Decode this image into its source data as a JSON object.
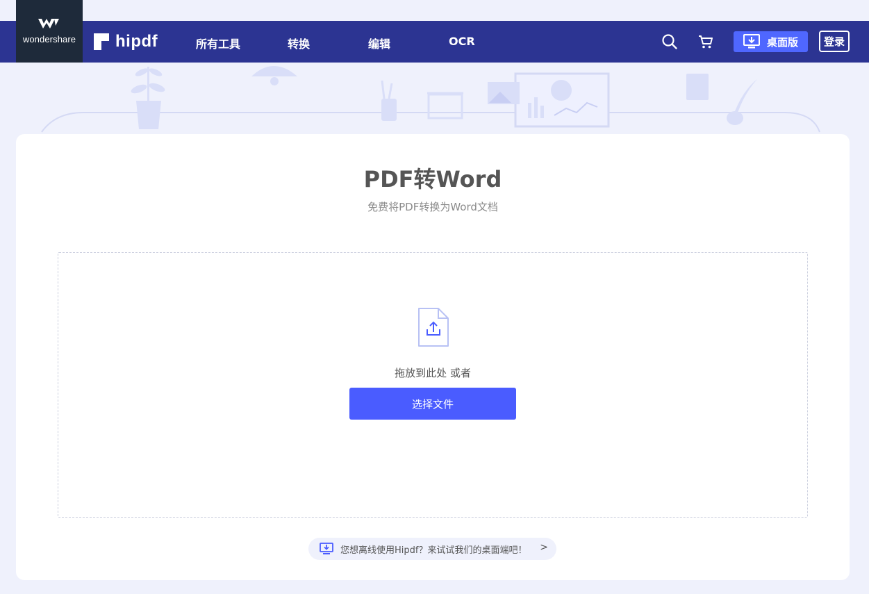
{
  "brand": {
    "wondershare": "wondershare",
    "hipdf": "hipdf"
  },
  "nav": {
    "items": [
      "所有工具",
      "转换",
      "编辑",
      "OCR"
    ],
    "search_icon": "search-icon",
    "cart_icon": "cart-icon",
    "desktop_label": "桌面版",
    "login_label": "登录"
  },
  "main": {
    "title": "PDF转Word",
    "subtitle": "免费将PDF转换为Word文档",
    "drop_text": "拖放到此处 或者",
    "choose_button": "选择文件",
    "promo_text": "您想离线使用Hipdf？来试试我们的桌面端吧！",
    "promo_chevron": ">"
  },
  "colors": {
    "nav_bg": "#2c3492",
    "accent": "#4a5cff",
    "page_bg": "#eff1fc"
  }
}
